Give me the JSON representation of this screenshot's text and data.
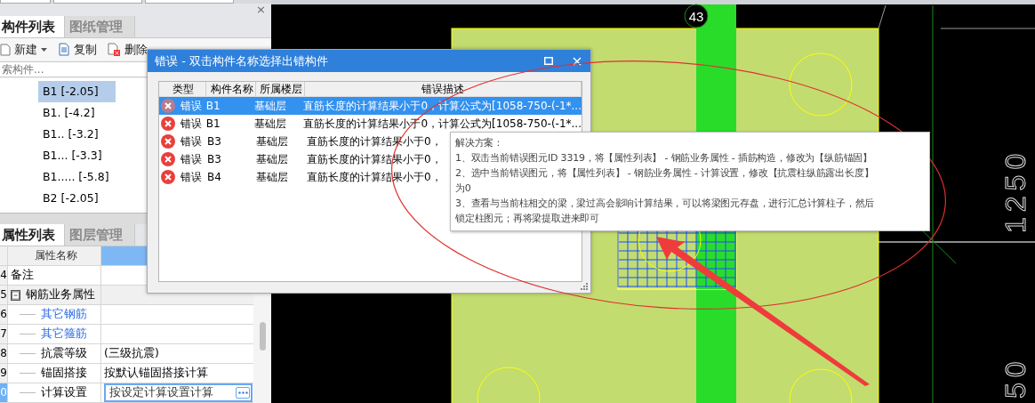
{
  "left_panel": {
    "close": "×",
    "component_tabs": [
      {
        "label": "构件列表",
        "selected": true
      },
      {
        "label": "图纸管理",
        "selected": false
      }
    ],
    "toolbar": [
      {
        "label": "新建",
        "kind": "dropdown"
      },
      {
        "label": "复制",
        "kind": "copy"
      },
      {
        "label": "删除",
        "kind": "delete"
      }
    ],
    "search": {
      "placeholder": "索构件..."
    },
    "components": [
      {
        "label": "B1 [-2.05]",
        "selected": true
      },
      {
        "label": "B1. [-4.2]",
        "selected": false
      },
      {
        "label": "B1.. [-3.2]",
        "selected": false
      },
      {
        "label": "B1... [-3.3]",
        "selected": false
      },
      {
        "label": "B1..... [-5.8]",
        "selected": false
      },
      {
        "label": "B2 [-2.05]",
        "selected": false
      }
    ],
    "property_tabs": [
      {
        "label": "属性列表",
        "selected": true
      },
      {
        "label": "图层管理",
        "selected": false
      }
    ],
    "property_table": {
      "columns": [
        "属性名称"
      ],
      "rows": [
        {
          "number": "4",
          "name": "备注",
          "kind": "text",
          "selected": false
        },
        {
          "number": "5",
          "name": "钢筋业务属性",
          "kind": "group",
          "expanded": true,
          "selected": false,
          "children": [
            {
              "number": "6",
              "name": "其它钢筋",
              "kind": "link",
              "selected": false
            },
            {
              "number": "7",
              "name": "其它箍筋",
              "kind": "link",
              "selected": false
            },
            {
              "number": "8",
              "name": "抗震等级",
              "kind": "text",
              "value": "(三级抗震)",
              "selected": false
            },
            {
              "number": "9",
              "name": "锚固搭接",
              "kind": "text",
              "value": "按默认锚固搭接计算",
              "selected": false
            },
            {
              "number": "0",
              "name": "计算设置",
              "kind": "text",
              "value": "按设定计算设置计算",
              "selected": true
            }
          ]
        }
      ]
    }
  },
  "canvas": {
    "axis_label": "43",
    "dimension_labels": [
      "1250",
      "50"
    ]
  },
  "error_dialog": {
    "title": "错误 - 双击构件名称选择出错构件",
    "columns": [
      "类型",
      "构件名称",
      "所属楼层",
      "错误描述"
    ],
    "rows": [
      {
        "type": "错误",
        "name": "B1",
        "floor": "基础层",
        "description": "直筋长度的计算结果小于0，计算公式为[1058-750-(-1*...",
        "selected": true
      },
      {
        "type": "错误",
        "name": "B1",
        "floor": "基础层",
        "description": "直筋长度的计算结果小于0，计算公式为[1058-750-(-1*...",
        "selected": false
      },
      {
        "type": "错误",
        "name": "B3",
        "floor": "基础层",
        "description": "直筋长度的计算结果小于0，",
        "selected": false
      },
      {
        "type": "错误",
        "name": "B3",
        "floor": "基础层",
        "description": "直筋长度的计算结果小于0，",
        "selected": false
      },
      {
        "type": "错误",
        "name": "B4",
        "floor": "基础层",
        "description": "直筋长度的计算结果小于0，",
        "selected": false
      }
    ]
  },
  "solution_tooltip": {
    "title": "解决方案：",
    "lines": [
      "1、双击当前错误图元ID 3319，将【属性列表】 - 钢筋业务属性 - 插筋构造，修改为【纵筋锚固】",
      "2、选中当前错误图元，将【属性列表】 - 钢筋业务属性 - 计算设置，修改【抗震柱纵筋露出长度】为0",
      "3、查看与当前柱相交的梁，梁过高会影响计算结果，可以将梁图元存盘，进行汇总计算柱子，然后锁定柱图元；再将梁提取进来即可"
    ]
  }
}
